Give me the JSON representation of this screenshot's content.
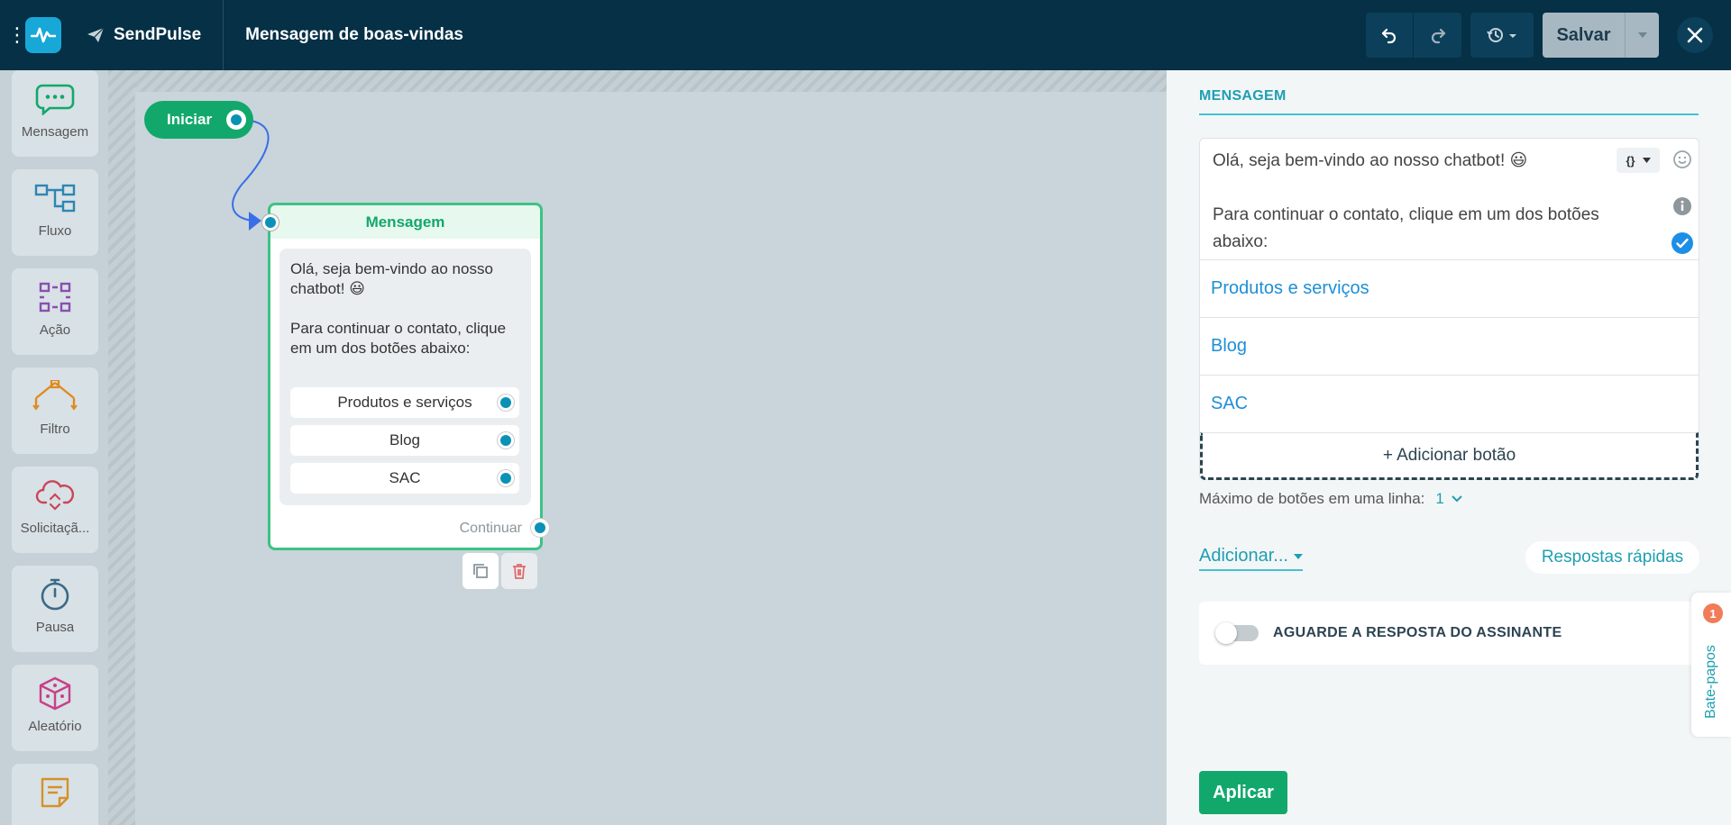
{
  "header": {
    "brand": "SendPulse",
    "doc_title": "Mensagem de boas-vindas",
    "save_label": "Salvar"
  },
  "sidebar": {
    "items": [
      {
        "label": "Mensagem",
        "icon": "chat-bubble-icon"
      },
      {
        "label": "Fluxo",
        "icon": "flow-icon"
      },
      {
        "label": "Ação",
        "icon": "action-icon"
      },
      {
        "label": "Filtro",
        "icon": "filter-icon"
      },
      {
        "label": "Solicitaçã...",
        "icon": "cloud-request-icon"
      },
      {
        "label": "Pausa",
        "icon": "stopwatch-icon"
      },
      {
        "label": "Aleatório",
        "icon": "dice-icon"
      },
      {
        "label": "",
        "icon": "note-icon"
      }
    ]
  },
  "canvas": {
    "start_label": "Iniciar",
    "node": {
      "title": "Mensagem",
      "text": "Olá, seja bem-vindo ao nosso chatbot! 😃\n\nPara continuar o contato, clique em um dos botões abaixo:",
      "buttons": [
        "Produtos e serviços",
        "Blog",
        "SAC"
      ],
      "continue_label": "Continuar"
    }
  },
  "panel": {
    "tab": "MENSAGEM",
    "message_text": "Olá, seja bem-vindo ao nosso chatbot! 😃\n\nPara continuar o contato, clique em um dos botões abaixo:",
    "var_label": "{}",
    "buttons": [
      "Produtos e serviços",
      "Blog",
      "SAC"
    ],
    "add_button_label": "+ Adicionar botão",
    "max_label": "Máximo de botões em uma linha:",
    "max_value": "1",
    "add_label": "Adicionar...",
    "quick_replies_label": "Respostas rápidas",
    "wait_label": "AGUARDE A RESPOSTA DO ASSINANTE",
    "wait_enabled": false,
    "apply_label": "Aplicar"
  },
  "chat_tab": {
    "label": "Bate-papos",
    "badge": "1"
  },
  "colors": {
    "topbar": "#053046",
    "accent_green": "#12a86c",
    "accent_teal": "#1e9fb2",
    "port_blue": "#0a91b6"
  }
}
